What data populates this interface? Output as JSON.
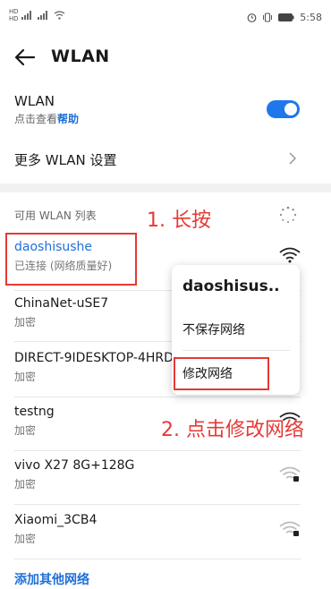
{
  "status_bar": {
    "time": "5:58"
  },
  "header": {
    "title": "WLAN"
  },
  "wlan_toggle": {
    "label": "WLAN",
    "hint_prefix": "点击查看",
    "hint_link": "帮助",
    "enabled": true
  },
  "more_settings": {
    "label": "更多 WLAN 设置"
  },
  "available": {
    "label": "可用 WLAN 列表"
  },
  "networks": [
    {
      "name": "daoshisushe",
      "status": "已连接 (网络质量好)",
      "active": true
    },
    {
      "name": "ChinaNet-uSE7",
      "status": "加密"
    },
    {
      "name": "DIRECT-9IDESKTOP-4HRD",
      "status": "加密"
    },
    {
      "name": "testng",
      "status": "加密"
    },
    {
      "name": "vivo X27 8G+128G",
      "status": "加密"
    },
    {
      "name": "Xiaomi_3CB4",
      "status": "加密"
    }
  ],
  "context_menu": {
    "title": "daoshisus..",
    "items": [
      "不保存网络",
      "修改网络"
    ]
  },
  "annotations": {
    "step1": "1. 长按",
    "step2": "2. 点击修改网络"
  },
  "add_network": {
    "label": "添加其他网络"
  },
  "colors": {
    "accent": "#1f6fd8",
    "toggle": "#1e78ec",
    "annotation": "#e53935"
  }
}
